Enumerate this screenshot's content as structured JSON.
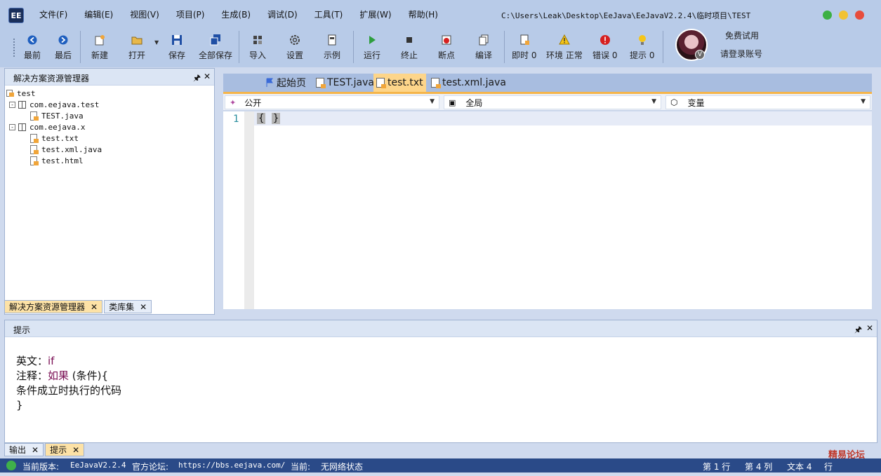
{
  "app": {
    "logo_text": "EE",
    "title_path": "C:\\Users\\Leak\\Desktop\\EeJava\\EeJavaV2.2.4\\临时项目\\TEST"
  },
  "menu": [
    "文件(F)",
    "编辑(E)",
    "视图(V)",
    "项目(P)",
    "生成(B)",
    "调试(D)",
    "工具(T)",
    "扩展(W)",
    "帮助(H)"
  ],
  "window_controls": {
    "close_color": "#e74c3c",
    "minimize_color": "#f1c232",
    "maximize_color": "#3cb043"
  },
  "toolbar": {
    "back": "最前",
    "forward": "最后",
    "new": "新建",
    "open": "打开",
    "save": "保存",
    "save_all": "全部保存",
    "import": "导入",
    "settings": "设置",
    "example": "示例",
    "run": "运行",
    "stop": "终止",
    "breakpoint": "断点",
    "compile": "编译",
    "instant": "即时 0",
    "environment": "环境 正常",
    "errors": "错误 0",
    "hints": "提示 0"
  },
  "account": {
    "free_trial": "免费试用",
    "login": "请登录账号",
    "badge": "V"
  },
  "solution_explorer": {
    "title": "解决方案资源管理器",
    "pin": "▐",
    "root": "test",
    "packages": [
      {
        "name": "com.eejava.test",
        "files": [
          "TEST.java"
        ]
      },
      {
        "name": "com.eejava.x",
        "files": [
          "test.txt",
          "test.xml.java",
          "test.html"
        ]
      }
    ]
  },
  "left_tabs": [
    {
      "label": "解决方案资源管理器",
      "active": true
    },
    {
      "label": "类库集",
      "active": false
    }
  ],
  "editor": {
    "tabs": [
      {
        "label": "起始页",
        "active": false
      },
      {
        "label": "TEST.java",
        "active": false
      },
      {
        "label": "test.txt",
        "active": true
      },
      {
        "label": "test.xml.java",
        "active": false
      }
    ],
    "dropdowns": {
      "access": "公开",
      "scope": "全局",
      "variable": "变量"
    },
    "line_number": "1",
    "code_open": "{",
    "code_close": "}"
  },
  "hint_panel": {
    "title": "提示",
    "english_label": "英文：",
    "english_value": "if",
    "note_label": "注释：",
    "note_value": "如果",
    "note_rest": " (条件){",
    "line3": "条件成立时执行的代码",
    "line4": "}"
  },
  "bottom_tabs": [
    {
      "label": "输出",
      "active": false
    },
    {
      "label": "提示",
      "active": true
    }
  ],
  "statusbar": {
    "version_label": "当前版本:",
    "version": "EeJavaV2.2.4",
    "forum_label": "官方论坛:",
    "forum_url": "https://bbs.eejava.com/",
    "current_label": "当前:",
    "network": "无网络状态",
    "row": "第 1 行",
    "col": "第 4 列",
    "text": "文本 4",
    "extra": "行"
  },
  "watermark": "精易论坛"
}
